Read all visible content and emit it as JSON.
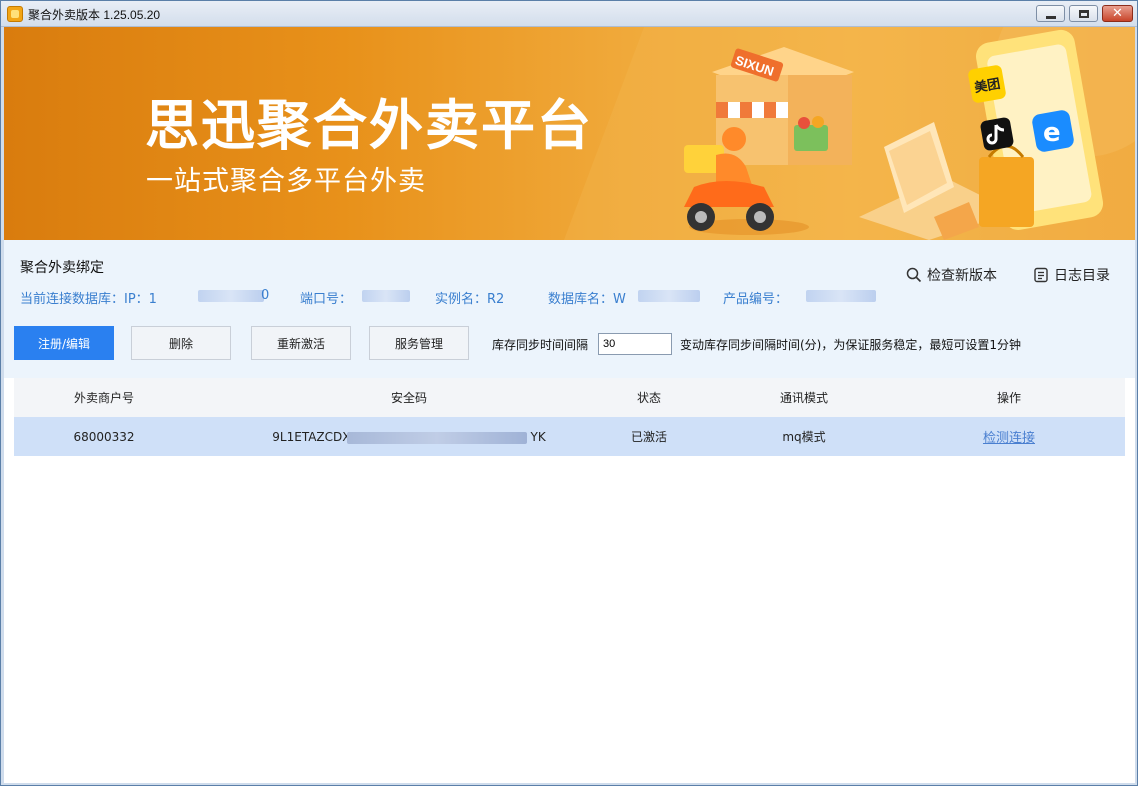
{
  "window": {
    "title": "聚合外卖版本 1.25.05.20",
    "controls": {
      "minimize": "minimize",
      "maximize": "maximize",
      "close": "✕"
    }
  },
  "banner": {
    "title": "思迅聚合外卖平台",
    "subtitle": "一站式聚合多平台外卖",
    "store_sign": "SIXUN",
    "app_badges": {
      "meituan": "美团",
      "eleme": "e"
    }
  },
  "panel": {
    "bind_title": "聚合外卖绑定",
    "connection": {
      "db_label": "当前连接数据库：IP：1",
      "db_suffix": "0",
      "port_label": "端口号：",
      "instance_label": "实例名：R2",
      "dbname_label": "数据库名：W",
      "product_label": "产品编号："
    },
    "tools": {
      "check_update": "检查新版本",
      "log_dir": "日志目录"
    },
    "buttons": {
      "register_edit": "注册/编辑",
      "delete": "删除",
      "reactivate": "重新激活",
      "service_manage": "服务管理"
    },
    "sync": {
      "label": "库存同步时间间隔",
      "value": "30",
      "hint": "变动库存同步间隔时间(分)，为保证服务稳定，最短可设置1分钟"
    }
  },
  "table": {
    "headers": [
      "外卖商户号",
      "安全码",
      "状态",
      "通讯模式",
      "操作"
    ],
    "rows": [
      {
        "merchant_id": "68000332",
        "security_code_visible": "9L1ETAZCDX",
        "security_code_tail": "YK",
        "status": "已激活",
        "mode": "mq模式",
        "action": "检测连接"
      }
    ]
  }
}
